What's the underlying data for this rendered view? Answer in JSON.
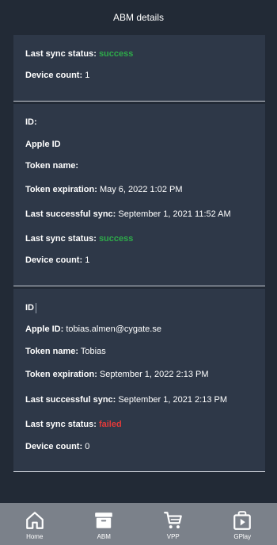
{
  "header": {
    "title": "ABM details"
  },
  "card1": {
    "sync_status_label": "Last sync status:",
    "sync_status_value": "success",
    "device_count_label": "Device count:",
    "device_count_value": "1"
  },
  "card2": {
    "id_label": "ID:",
    "apple_id_label": "Apple ID",
    "token_name_label": "Token name:",
    "token_expiration_label": "Token expiration:",
    "token_expiration_value": "May 6, 2022 1:02 PM",
    "last_sync_label": "Last successful sync:",
    "last_sync_value": "September 1, 2021 11:52 AM",
    "sync_status_label": "Last sync status:",
    "sync_status_value": "success",
    "device_count_label": "Device count:",
    "device_count_value": "1"
  },
  "card3": {
    "id_label": "ID",
    "apple_id_label": "Apple ID:",
    "apple_id_value": "tobias.almen@cygate.se",
    "token_name_label": "Token name:",
    "token_name_value": "Tobias",
    "token_expiration_label": "Token expiration:",
    "token_expiration_value": "September 1, 2022 2:13 PM",
    "last_sync_label": "Last successful sync:",
    "last_sync_value": "September 1, 2021 2:13 PM",
    "sync_status_label": "Last sync status:",
    "sync_status_value": "failed",
    "device_count_label": "Device count:",
    "device_count_value": "0"
  },
  "nav": {
    "items": [
      {
        "label": "Home",
        "icon": "home-icon"
      },
      {
        "label": "ABM",
        "icon": "archive-box-icon"
      },
      {
        "label": "VPP",
        "icon": "shopping-cart-icon"
      },
      {
        "label": "GPlay",
        "icon": "play-store-icon"
      }
    ]
  },
  "colors": {
    "background": "#222a36",
    "card": "#2e3848",
    "success": "#2eaa4a",
    "failed": "#e23a3a",
    "nav": "#7b818a"
  }
}
